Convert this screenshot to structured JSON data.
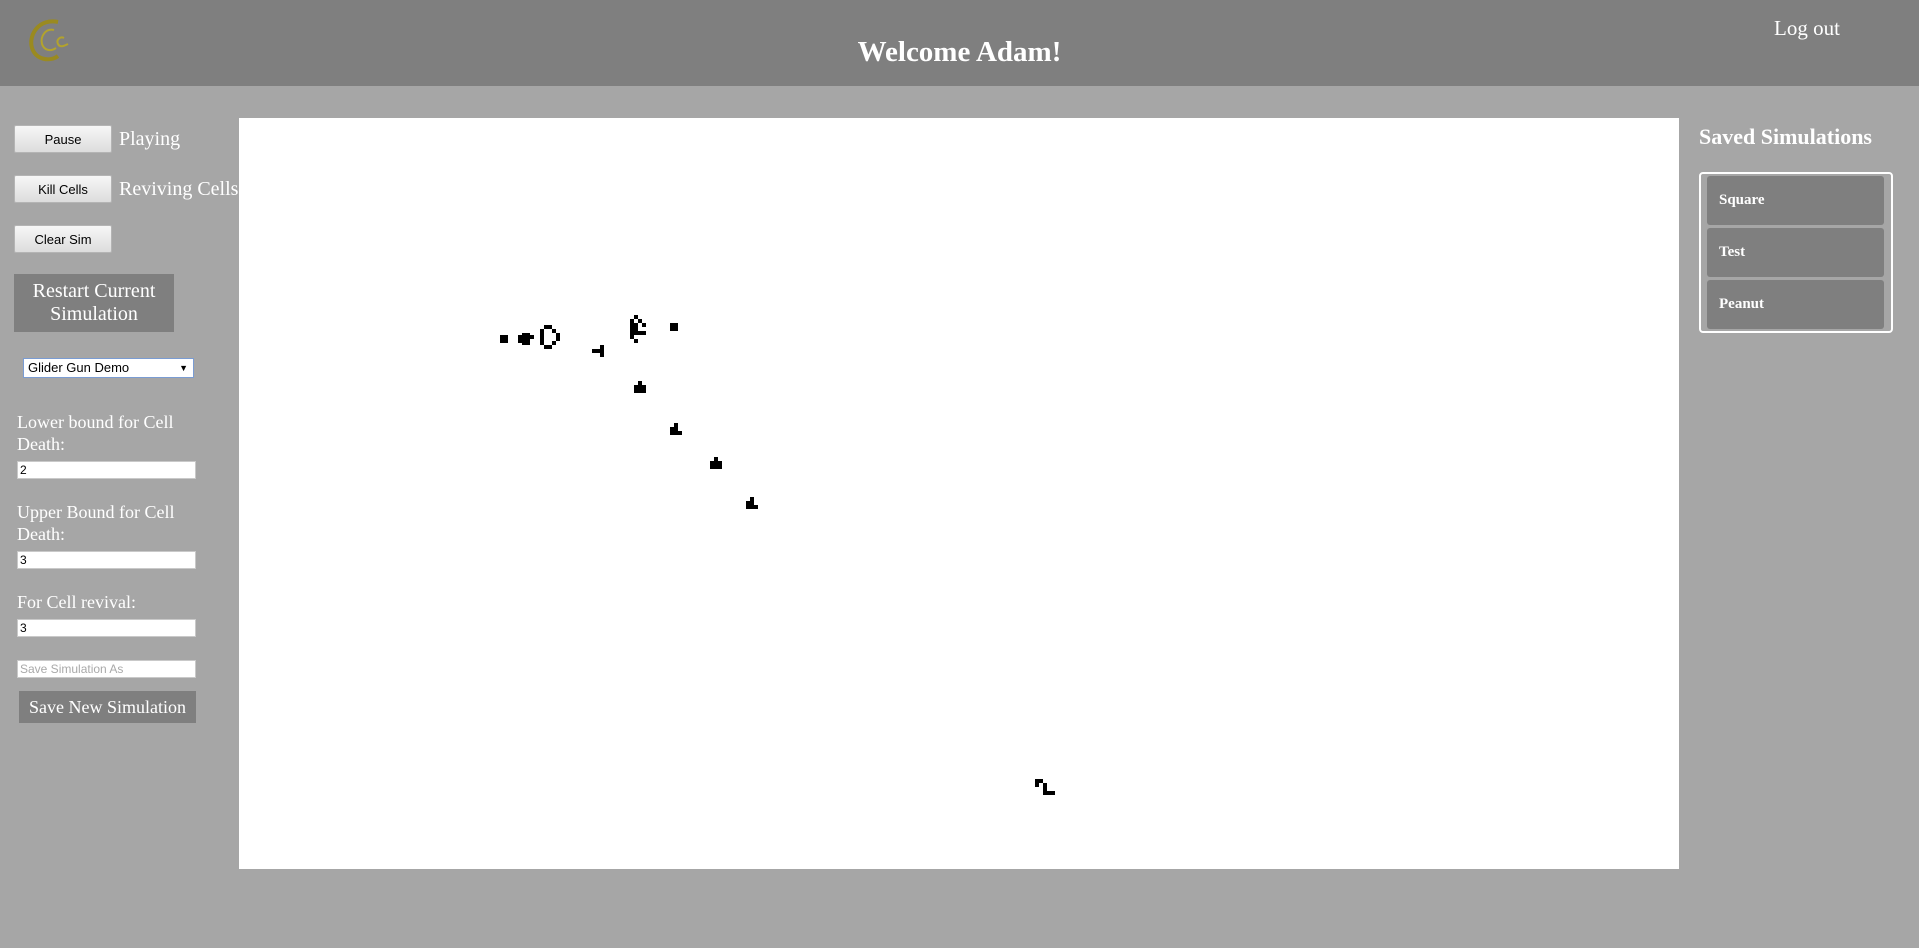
{
  "header": {
    "logo_icon": "ccc-logo-icon",
    "welcome": "Welcome Adam!",
    "logout": "Log out"
  },
  "controls": {
    "pause_label": "Pause",
    "play_status": "Playing",
    "kill_label": "Kill Cells",
    "kill_status": "Reviving Cells",
    "clear_label": "Clear Sim",
    "restart_label": "Restart Current Simulation",
    "preset_selected": "Glider Gun Demo",
    "lower_label": "Lower bound for Cell Death:",
    "lower_value": "2",
    "upper_label": "Upper Bound for Cell Death:",
    "upper_value": "3",
    "revival_label": "For Cell revival:",
    "revival_value": "3",
    "save_placeholder": "Save Simulation As",
    "save_label": "Save New Simulation"
  },
  "saved": {
    "title": "Saved Simulations",
    "items": [
      "Square",
      "Test",
      "Peanut"
    ]
  },
  "colors": {
    "header_bg": "#7f7f7f",
    "page_bg": "#a6a6a6",
    "board_bg": "#ffffff",
    "logo_color": "#9a8a20"
  }
}
